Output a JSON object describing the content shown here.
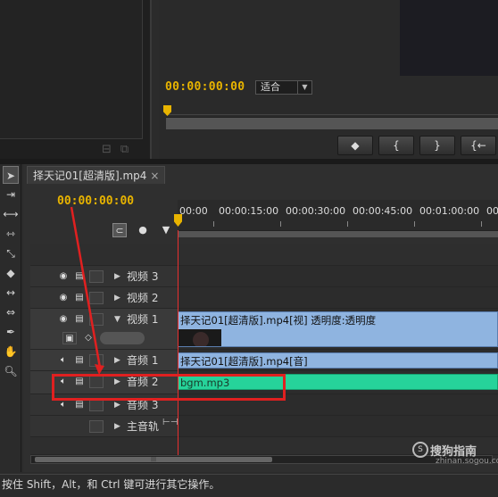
{
  "program_monitor": {
    "timecode": "00:00:00:00",
    "fit_label": "适合",
    "buttons": [
      "◆",
      "{",
      "}",
      "{←"
    ]
  },
  "timeline": {
    "tab_label": "择天记01[超清版].mp4",
    "tab_close": "×",
    "timecode": "00:00:00:00",
    "ruler_labels": [
      "00:00",
      "00:00:15:00",
      "00:00:30:00",
      "00:00:45:00",
      "00:01:00:00",
      "00"
    ],
    "tracks": [
      {
        "name": "视频 3",
        "kind": "video"
      },
      {
        "name": "视频 2",
        "kind": "video"
      },
      {
        "name": "视频 1",
        "kind": "video"
      },
      {
        "name": "音频 1",
        "kind": "audio"
      },
      {
        "name": "音频 2",
        "kind": "audio"
      },
      {
        "name": "音频 3",
        "kind": "audio"
      },
      {
        "name": "主音轨",
        "kind": "master"
      }
    ],
    "clips": {
      "video1": "择天记01[超清版].mp4[视] 透明度:透明度",
      "audio1": "择天记01[超清版].mp4[音]",
      "audio2": "bgm.mp3"
    }
  },
  "status_bar": {
    "text": "按住 Shift，Alt，和 Ctrl 键可进行其它操作。"
  },
  "watermark": {
    "title": "搜狗指南",
    "subtitle": "zhinan.sogou.com"
  },
  "colors": {
    "timecode": "#e8b400",
    "clip_blue": "#8fb4e0",
    "clip_green": "#26d39a",
    "highlight_red": "#e02020"
  }
}
